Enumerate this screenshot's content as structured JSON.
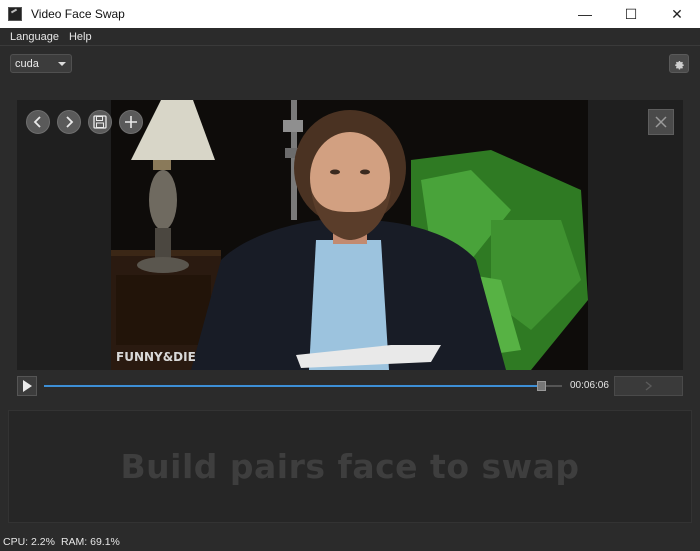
{
  "window": {
    "title": "Video Face Swap",
    "controls": {
      "minimize": "—",
      "maximize": "☐",
      "close": "✕"
    }
  },
  "menu": {
    "items": [
      "Language",
      "Help"
    ]
  },
  "toolbar": {
    "device_select": {
      "value": "cuda",
      "icon": "chevron-down-icon"
    },
    "settings_icon": "gear-icon"
  },
  "preview": {
    "nav_icons": [
      "chevron-left-icon",
      "chevron-right-icon",
      "save-icon",
      "add-icon"
    ],
    "close_icon": "close-icon",
    "watermark": "FUNNY&DIE"
  },
  "player": {
    "play_icon": "play-icon",
    "position_fraction": 0.96,
    "time": "00:06:06",
    "swap_icon": "swap-arrow-icon"
  },
  "pairs": {
    "placeholder": "Build pairs face to swap"
  },
  "status": {
    "cpu": "CPU: 2.2%",
    "ram": "RAM: 69.1%"
  },
  "colors": {
    "accent": "#3d8fd6",
    "background": "#2b2b2b",
    "panel": "#1f1f1f"
  }
}
